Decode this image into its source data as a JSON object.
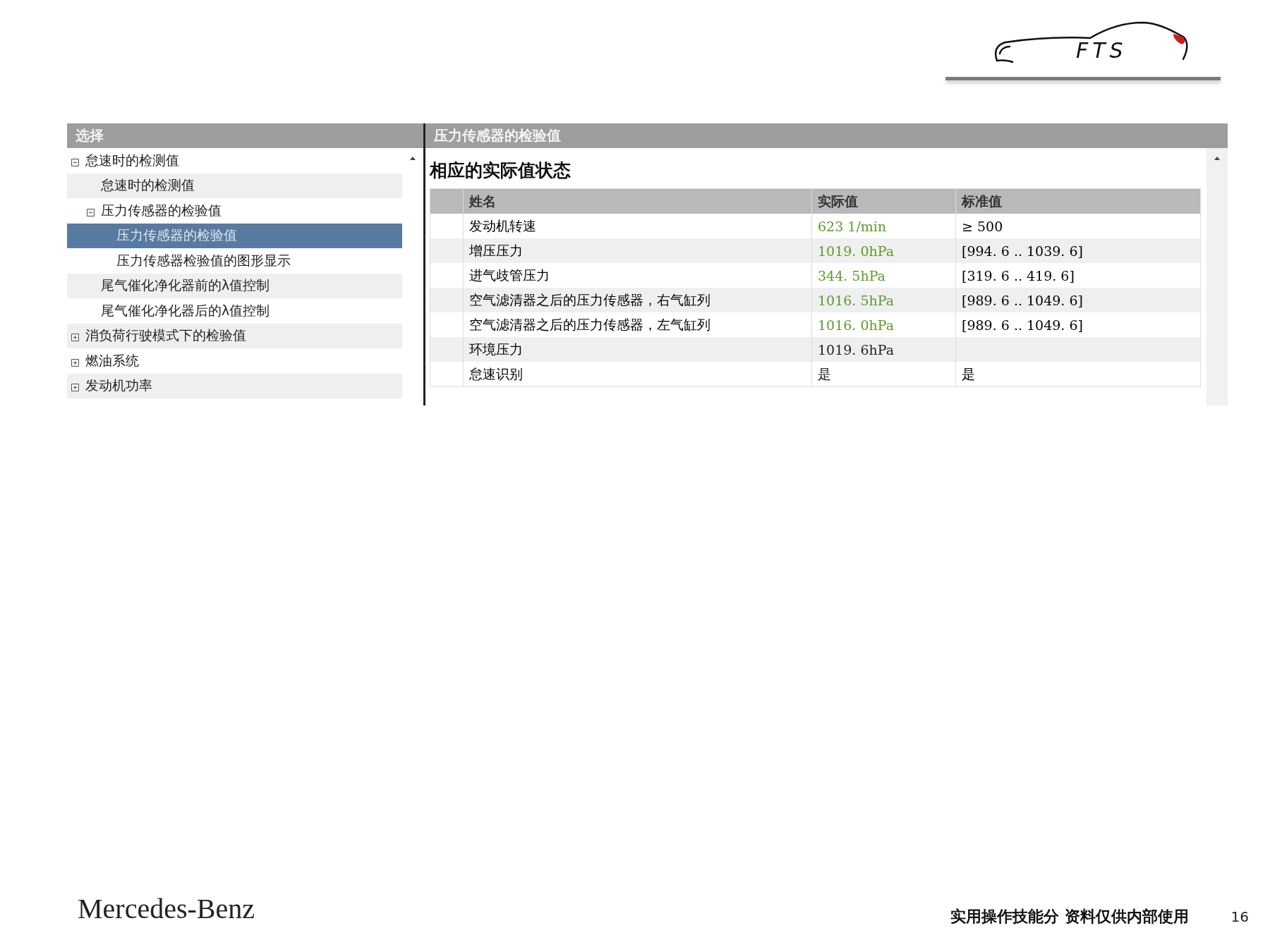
{
  "logo": {
    "text": "FTS"
  },
  "tree_panel": {
    "header": "选择",
    "items": [
      {
        "label": "怠速时的检测值",
        "expanded": true,
        "selected": false,
        "children": [
          {
            "label": "怠速时的检测值",
            "selected": false
          },
          {
            "label": "压力传感器的检验值",
            "expanded": true,
            "selected": false,
            "children": [
              {
                "label": "压力传感器的检验值",
                "selected": true
              },
              {
                "label": "压力传感器检验值的图形显示",
                "selected": false
              }
            ]
          },
          {
            "label": "尾气催化净化器前的λ值控制",
            "selected": false
          },
          {
            "label": "尾气催化净化器后的λ值控制",
            "selected": false
          }
        ]
      },
      {
        "label": "消负荷行驶模式下的检验值",
        "expanded": false,
        "selected": false
      },
      {
        "label": "燃油系统",
        "expanded": false,
        "selected": false
      },
      {
        "label": "发动机功率",
        "expanded": false,
        "selected": false
      }
    ]
  },
  "detail_panel": {
    "header": "压力传感器的检验值",
    "heading": "相应的实际值状态",
    "table": {
      "columns": [
        "姓名",
        "实际值",
        "标准值"
      ],
      "rows": [
        {
          "name": "发动机转速",
          "actual": "623 1/min",
          "ok": true,
          "standard": "≥ 500"
        },
        {
          "name": "增压压力",
          "actual": "1019. 0hPa",
          "ok": true,
          "standard": "[994. 6 ..  1039. 6]"
        },
        {
          "name": "进气歧管压力",
          "actual": "344. 5hPa",
          "ok": true,
          "standard": "[319. 6 ..  419. 6]"
        },
        {
          "name": "空气滤清器之后的压力传感器，右气缸列",
          "actual": "1016. 5hPa",
          "ok": true,
          "standard": "[989. 6 ..  1049. 6]"
        },
        {
          "name": "空气滤清器之后的压力传感器，左气缸列",
          "actual": "1016. 0hPa",
          "ok": true,
          "standard": "[989. 6 ..  1049. 6]"
        },
        {
          "name": "环境压力",
          "actual": "1019. 6hPa",
          "ok": false
        },
        {
          "name": "怠速识别",
          "actual": "是",
          "ok": false,
          "standard": "是"
        }
      ]
    }
  },
  "footer": {
    "brand": "Mercedes-Benz",
    "note": "实用操作技能分 资料仅供内部使用",
    "page": "16"
  }
}
